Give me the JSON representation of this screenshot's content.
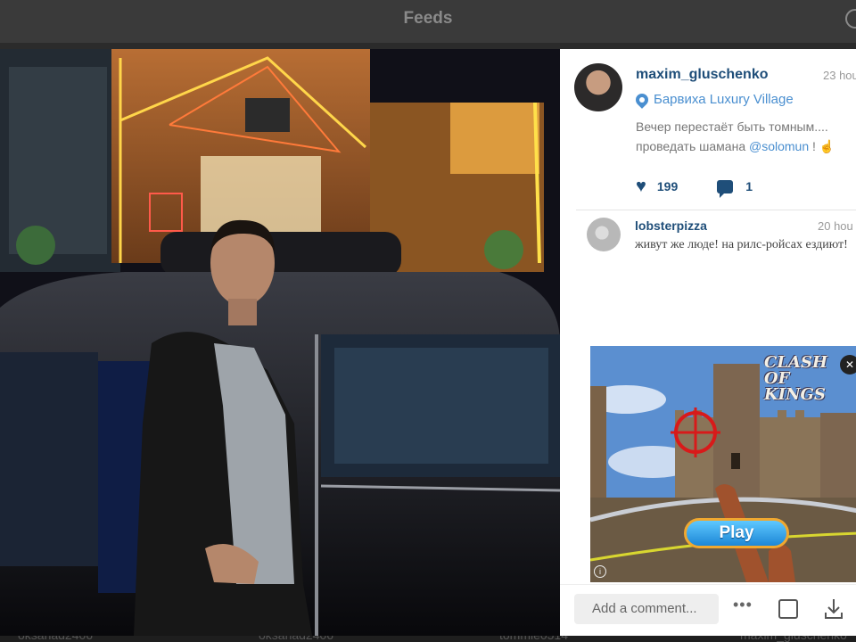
{
  "topbar": {
    "title": "Feeds"
  },
  "background_strip": [
    "oksanad2406",
    "oksanad2406",
    "tommie0514",
    "maxim_gluschenko"
  ],
  "post": {
    "username": "maxim_gluschenko",
    "time": "23 hou",
    "location": "Барвиха Luxury Village",
    "caption_line1": "Вечер перестаёт быть томным....",
    "caption_line2_before": "проведать шамана ",
    "caption_mention": "@solomun",
    "caption_line2_after": " ! ☝",
    "likes": "199",
    "comments": "1"
  },
  "comment": {
    "username": "lobsterpizza",
    "time": "20 hou",
    "text": "живут же люде!  на рилс-ройсах ездиют!"
  },
  "ad": {
    "logo_line1": "CLASH OF",
    "logo_line2": "KINGS",
    "play_label": "Play",
    "info_label": "i",
    "close_label": "✕"
  },
  "footer": {
    "add_comment": "Add a comment...",
    "more": "•••"
  },
  "colors": {
    "accent": "#1f4e79",
    "link": "#4a8fd0"
  }
}
